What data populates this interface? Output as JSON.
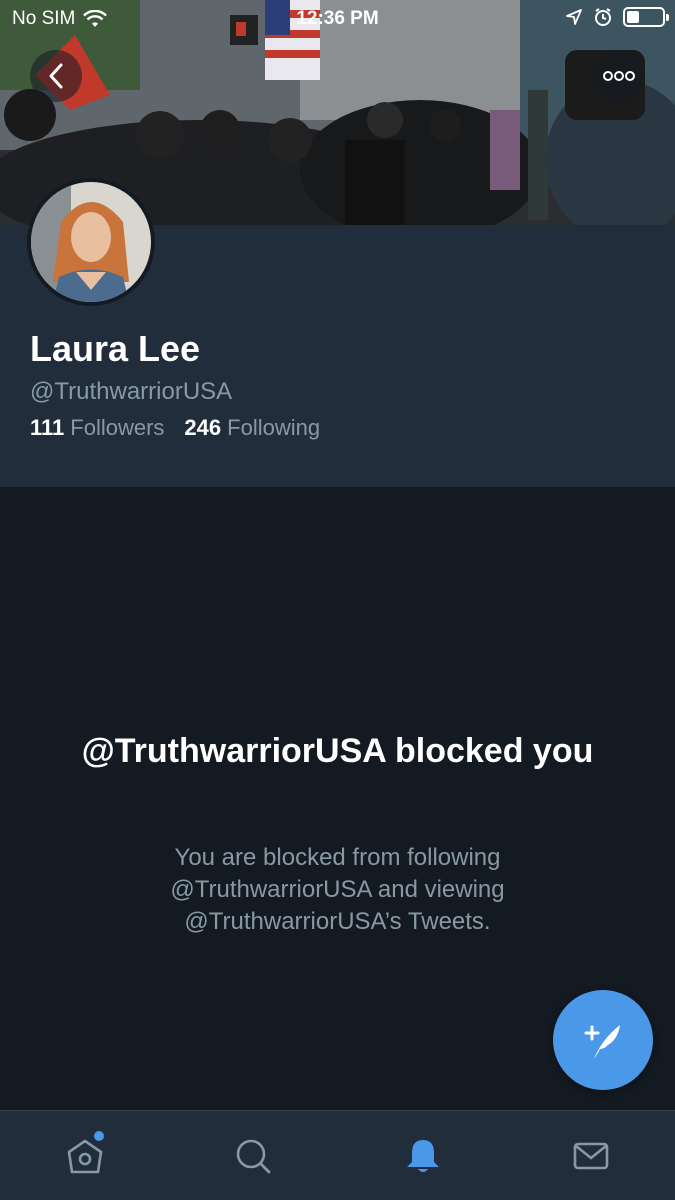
{
  "status_bar": {
    "carrier": "No SIM",
    "time": "12:36 PM"
  },
  "profile": {
    "name": "Laura Lee",
    "handle": "@TruthwarriorUSA",
    "followers_count": "111",
    "followers_label": "Followers",
    "following_count": "246",
    "following_label": "Following"
  },
  "blocked_notice": {
    "title": "@TruthwarriorUSA blocked you",
    "description": "You are blocked from following @TruthwarriorUSA and viewing @TruthwarriorUSA’s Tweets."
  },
  "icons": {
    "back": "chevron-left-icon",
    "more": "more-dots-icon",
    "compose": "compose-tweet-icon",
    "home": "home-icon",
    "search": "search-icon",
    "notifications": "bell-icon",
    "messages": "mail-icon"
  },
  "tab_bar": {
    "active_tab": "notifications",
    "home_has_badge": true
  },
  "colors": {
    "accent": "#4a99e9",
    "background": "#141a22",
    "header_background": "#222d3b",
    "secondary_text": "#8899a6"
  }
}
